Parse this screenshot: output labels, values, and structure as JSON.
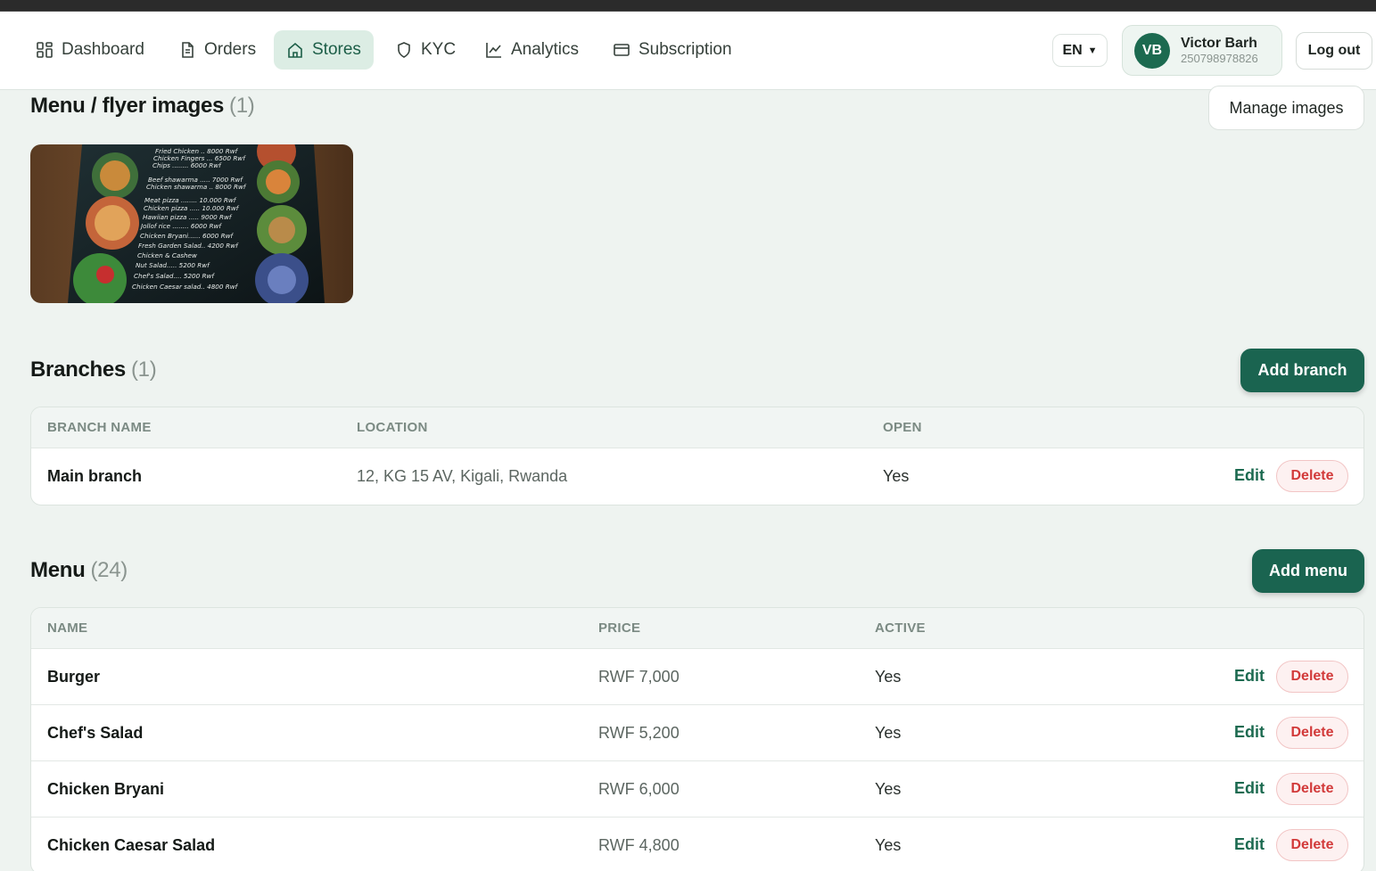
{
  "nav": {
    "items": [
      {
        "label": "Dashboard",
        "icon": "dashboard-grid-icon",
        "active": false
      },
      {
        "label": "Orders",
        "icon": "document-icon",
        "active": false
      },
      {
        "label": "Stores",
        "icon": "home-icon",
        "active": true
      },
      {
        "label": "KYC",
        "icon": "shield-icon",
        "active": false
      },
      {
        "label": "Analytics",
        "icon": "line-chart-icon",
        "active": false
      },
      {
        "label": "Subscription",
        "icon": "credit-card-icon",
        "active": false
      }
    ],
    "language": "EN",
    "user": {
      "initials": "VB",
      "name": "Victor Barh",
      "phone": "250798978826"
    },
    "logout_label": "Log out"
  },
  "flyers": {
    "title": "Menu / flyer images",
    "count": "(1)",
    "manage_label": "Manage images",
    "image_lines": [
      "Fried Chicken .. 8000 Rwf",
      "Chicken Fingers ... 6500 Rwf",
      "Chips ........ 6000 Rwf",
      "Beef shawarma ..... 7000 Rwf",
      "Chicken shawarma .. 8000 Rwf",
      "Meat pizza ........ 10.000 Rwf",
      "Chicken pizza ..... 10.000 Rwf",
      "Hawiian pizza ..... 9000 Rwf",
      "Jollof rice ........ 6000 Rwf",
      "Chicken Bryani...... 6000 Rwf",
      "Fresh Garden Salad.. 4200 Rwf",
      "Chicken & Cashew",
      "Nut Salad..... 5200 Rwf",
      "Chef's Salad.... 5200 Rwf",
      "Chicken Caesar salad.. 4800 Rwf"
    ]
  },
  "branches": {
    "title": "Branches",
    "count": "(1)",
    "add_label": "Add branch",
    "columns": [
      "BRANCH NAME",
      "LOCATION",
      "OPEN"
    ],
    "rows": [
      {
        "name": "Main branch",
        "location": "12, KG 15 AV, Kigali, Rwanda",
        "open": "Yes"
      }
    ]
  },
  "menu": {
    "title": "Menu",
    "count": "(24)",
    "add_label": "Add menu",
    "columns": [
      "NAME",
      "PRICE",
      "ACTIVE"
    ],
    "rows": [
      {
        "name": "Burger",
        "price": "RWF 7,000",
        "active": "Yes"
      },
      {
        "name": "Chef's Salad",
        "price": "RWF 5,200",
        "active": "Yes"
      },
      {
        "name": "Chicken Bryani",
        "price": "RWF 6,000",
        "active": "Yes"
      },
      {
        "name": "Chicken Caesar Salad",
        "price": "RWF 4,800",
        "active": "Yes"
      }
    ]
  },
  "actions": {
    "edit_label": "Edit",
    "delete_label": "Delete"
  },
  "colors": {
    "primary": "#1a6450",
    "active_nav_bg": "#dcede4",
    "danger": "#d23a3a",
    "page_bg": "#eef3f0"
  }
}
